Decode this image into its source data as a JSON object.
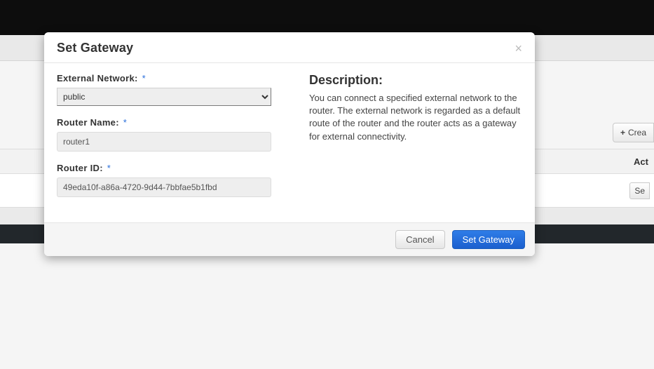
{
  "background": {
    "create_button_label": "Crea",
    "actions_header": "Act",
    "row_button_label": "Se"
  },
  "modal": {
    "title": "Set Gateway",
    "close_glyph": "×",
    "form": {
      "external_network": {
        "label": "External Network:",
        "required": "*",
        "selected": "public",
        "options": [
          "public"
        ]
      },
      "router_name": {
        "label": "Router Name:",
        "required": "*",
        "value": "router1"
      },
      "router_id": {
        "label": "Router ID:",
        "required": "*",
        "value": "49eda10f-a86a-4720-9d44-7bbfae5b1fbd"
      }
    },
    "description": {
      "heading": "Description:",
      "text": "You can connect a specified external network to the router. The external network is regarded as a default route of the router and the router acts as a gateway for external connectivity."
    },
    "buttons": {
      "cancel": "Cancel",
      "submit": "Set Gateway"
    }
  }
}
